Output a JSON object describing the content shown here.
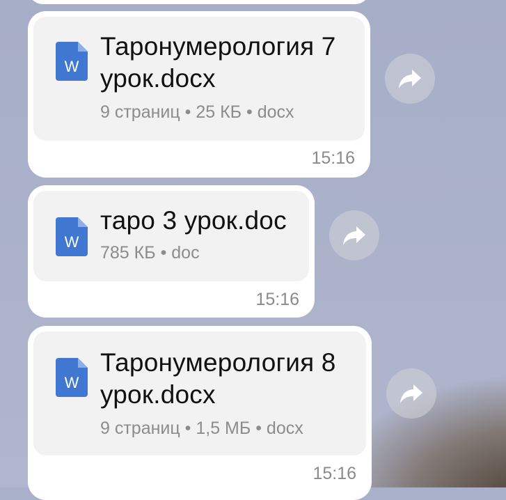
{
  "messages": [
    {
      "file_name": "Таронумерология 7 урок.docx",
      "file_meta": "9 страниц • 25 КБ • docx",
      "time": "15:16",
      "icon": "word-document-icon"
    },
    {
      "file_name": "таро 3 урок.doc",
      "file_meta": "785 КБ • doc",
      "time": "15:16",
      "icon": "word-document-icon"
    },
    {
      "file_name": "Таронумерология 8 урок.docx",
      "file_meta": "9 страниц • 1,5 МБ • docx",
      "time": "15:16",
      "icon": "word-document-icon"
    }
  ],
  "icons": {
    "share": "share-arrow-icon",
    "document": "word-document-icon"
  },
  "colors": {
    "word_blue": "#3f77d1",
    "bubble": "#ffffff",
    "file_card": "#f2f2f2"
  }
}
